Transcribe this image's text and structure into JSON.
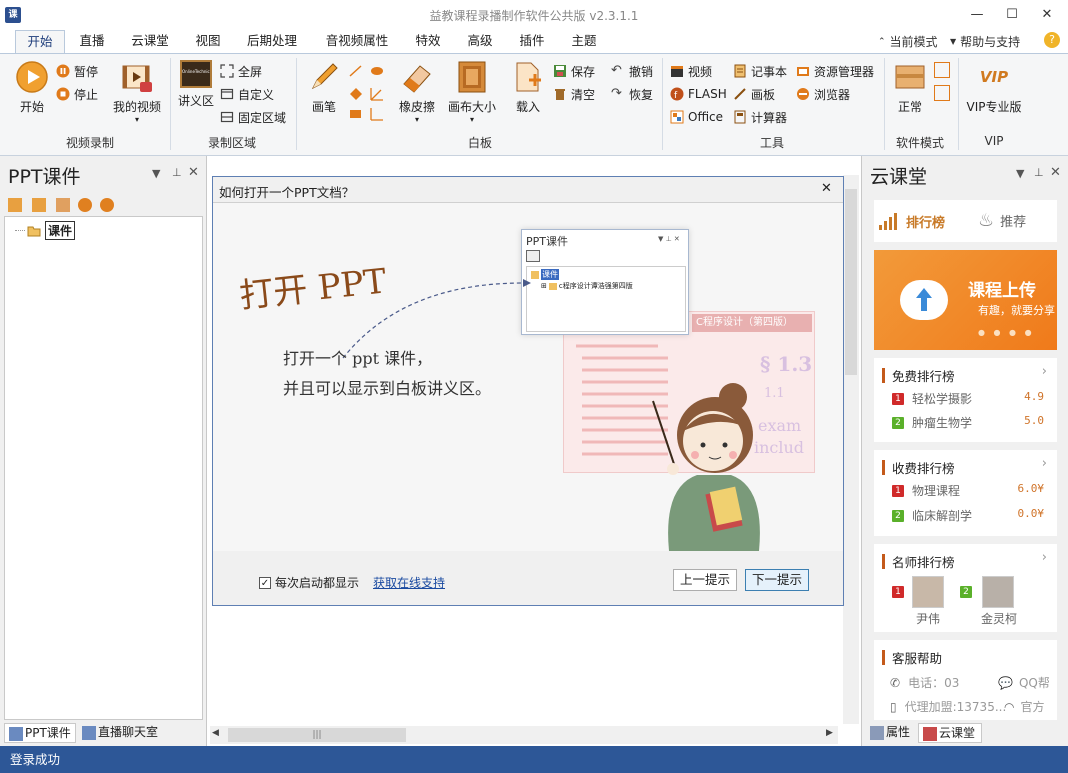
{
  "window": {
    "app_icon_text": "课",
    "title": "益教课程录播制作软件公共版 v2.3.1.1",
    "minimize": "—",
    "maximize": "☐",
    "close": "✕"
  },
  "menu": {
    "tabs": [
      "开始",
      "直播",
      "云课堂",
      "视图",
      "后期处理",
      "音视频属性",
      "特效",
      "高级",
      "插件",
      "主题"
    ],
    "active_tab": "开始",
    "right": {
      "current_mode": "当前模式",
      "help": "帮助与支持"
    }
  },
  "ribbon": {
    "video_record": {
      "start": "开始",
      "pause": "暂停",
      "stop": "停止",
      "my_video": "我的视频",
      "label": "视频录制"
    },
    "record_area": {
      "lecture": "讲义区",
      "lecture_icon_text": "OnlineTechnical",
      "fullscreen": "全屏",
      "custom": "自定义",
      "fixed": "固定区域",
      "label": "录制区域"
    },
    "whiteboard": {
      "pen": "画笔",
      "eraser": "橡皮擦",
      "canvas_size": "画布大小",
      "load": "载入",
      "save": "保存",
      "clear": "清空",
      "undo": "撤销",
      "redo": "恢复",
      "label": "白板"
    },
    "tools": {
      "video": "视频",
      "flash": "FLASH",
      "office": "Office",
      "notepad": "记事本",
      "paint": "画板",
      "calculator": "计算器",
      "explorer": "资源管理器",
      "browser": "浏览器",
      "label": "工具"
    },
    "mode": {
      "normal": "正常",
      "label": "软件模式"
    },
    "vip": {
      "pro": "VIP专业版",
      "label": "VIP",
      "badge": "VIP"
    }
  },
  "left_pane": {
    "title": "PPT课件",
    "tree_root": "课件",
    "bottom_tabs": [
      "PPT课件",
      "直播聊天室"
    ]
  },
  "dialog": {
    "title": "如何打开一个PPT文档？",
    "headline": "打开 PPT",
    "line1": "打开一个 ppt 课件，",
    "line2": "并且可以显示到白板讲义区。",
    "mini_title": "PPT课件",
    "mini_root": "课件",
    "mini_child": "c程序设计谭浩强第四版",
    "bg_heading": "C程序设计（第四版）",
    "bg_num": "§ 1.3",
    "bg_sub": "1.1",
    "bg_code1": "exam",
    "bg_code2": "includ",
    "checkbox_label": "每次启动都显示",
    "checkbox_checked": true,
    "link": "获取在线支持",
    "prev": "上一提示",
    "next": "下一提示"
  },
  "right_pane": {
    "title": "云课堂",
    "tabs": {
      "ranking": "排行榜",
      "recommend": "推荐"
    },
    "banner": {
      "title": "课程上传",
      "subtitle": "有趣，就要分享"
    },
    "free_rank": {
      "title": "免费排行榜",
      "items": [
        {
          "num": "1",
          "name": "轻松学摄影",
          "value": "4.9"
        },
        {
          "num": "2",
          "name": "肿瘤生物学",
          "value": "5.0"
        }
      ]
    },
    "paid_rank": {
      "title": "收费排行榜",
      "items": [
        {
          "num": "1",
          "name": "物理课程",
          "value": "6.0¥"
        },
        {
          "num": "2",
          "name": "临床解剖学",
          "value": "0.0¥"
        }
      ]
    },
    "teacher_rank": {
      "title": "名师排行榜",
      "items": [
        {
          "num": "1",
          "name": "尹伟"
        },
        {
          "num": "2",
          "name": "金灵柯"
        }
      ]
    },
    "service": {
      "title": "客服帮助",
      "phone": "电话：03",
      "qq": "QQ帮",
      "agent": "代理加盟:13735...",
      "official": "官方"
    },
    "bottom_tabs": [
      "属性",
      "云课堂"
    ]
  },
  "status": {
    "text": "登录成功"
  }
}
